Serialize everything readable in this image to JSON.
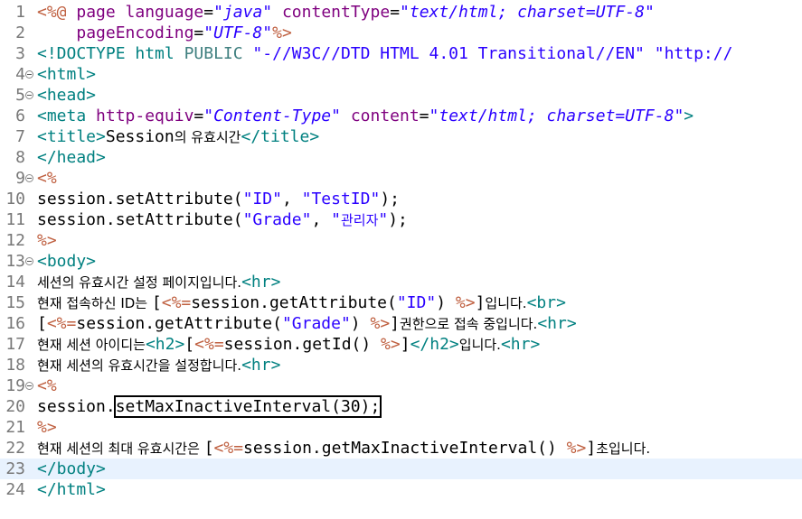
{
  "lines": [
    {
      "n": "1",
      "parts": [
        [
          "jsp",
          "<%@ "
        ],
        [
          "attr",
          "page "
        ],
        [
          "attr",
          "language"
        ],
        [
          "txt",
          "="
        ],
        [
          "str",
          "\"java\""
        ],
        [
          "txt",
          " "
        ],
        [
          "attr",
          "contentType"
        ],
        [
          "txt",
          "="
        ],
        [
          "str",
          "\"text/html; charset=UTF-8\""
        ]
      ]
    },
    {
      "n": "2",
      "parts": [
        [
          "txt",
          "    "
        ],
        [
          "attr",
          "pageEncoding"
        ],
        [
          "txt",
          "="
        ],
        [
          "str",
          "\"UTF-8\""
        ],
        [
          "jsp",
          "%>"
        ]
      ]
    },
    {
      "n": "3",
      "parts": [
        [
          "tag",
          "<!DOCTYPE html "
        ],
        [
          "kw",
          "PUBLIC "
        ],
        [
          "jstr",
          "\"-//W3C//DTD HTML 4.01 Transitional//EN\" \"http://"
        ]
      ]
    },
    {
      "n": "4",
      "fold": true,
      "parts": [
        [
          "tag",
          "<html>"
        ]
      ]
    },
    {
      "n": "5",
      "fold": true,
      "parts": [
        [
          "tag",
          "<head>"
        ]
      ]
    },
    {
      "n": "6",
      "parts": [
        [
          "tag",
          "<meta "
        ],
        [
          "attr",
          "http-equiv"
        ],
        [
          "txt",
          "="
        ],
        [
          "str",
          "\"Content-Type\""
        ],
        [
          "txt",
          " "
        ],
        [
          "attr",
          "content"
        ],
        [
          "txt",
          "="
        ],
        [
          "str",
          "\"text/html; charset=UTF-8\""
        ],
        [
          "tag",
          ">"
        ]
      ]
    },
    {
      "n": "7",
      "parts": [
        [
          "tag",
          "<title>"
        ],
        [
          "txt",
          "Session"
        ],
        [
          "ko",
          "의 유효시간"
        ],
        [
          "tag",
          "</title>"
        ]
      ]
    },
    {
      "n": "8",
      "parts": [
        [
          "tag",
          "</head>"
        ]
      ]
    },
    {
      "n": "9",
      "fold": true,
      "parts": [
        [
          "jsp",
          "<%"
        ]
      ]
    },
    {
      "n": "10",
      "parts": [
        [
          "txt",
          "session.setAttribute("
        ],
        [
          "jstr",
          "\"ID\""
        ],
        [
          "txt",
          ", "
        ],
        [
          "jstr",
          "\"TestID\""
        ],
        [
          "txt",
          ");"
        ]
      ]
    },
    {
      "n": "11",
      "parts": [
        [
          "txt",
          "session.setAttribute("
        ],
        [
          "jstr",
          "\"Grade\""
        ],
        [
          "txt",
          ", "
        ],
        [
          "jstr",
          "\""
        ],
        [
          "jstrko",
          "관리자"
        ],
        [
          "jstr",
          "\""
        ],
        [
          "txt",
          ");"
        ]
      ]
    },
    {
      "n": "12",
      "parts": [
        [
          "jsp",
          "%>"
        ]
      ]
    },
    {
      "n": "13",
      "fold": true,
      "parts": [
        [
          "tag",
          "<body>"
        ]
      ]
    },
    {
      "n": "14",
      "parts": [
        [
          "ko",
          "세션의 유효시간 설정 페이지입니다."
        ],
        [
          "tag",
          "<hr>"
        ]
      ]
    },
    {
      "n": "15",
      "parts": [
        [
          "ko",
          "현재 접속하신 ID는 "
        ],
        [
          "txt",
          "["
        ],
        [
          "jsp",
          "<%="
        ],
        [
          "txt",
          "session.getAttribute("
        ],
        [
          "jstr",
          "\"ID\""
        ],
        [
          "txt",
          ") "
        ],
        [
          "jsp",
          "%>"
        ],
        [
          "txt",
          "]"
        ],
        [
          "ko",
          "입니다."
        ],
        [
          "tag",
          "<br>"
        ]
      ]
    },
    {
      "n": "16",
      "parts": [
        [
          "txt",
          "["
        ],
        [
          "jsp",
          "<%="
        ],
        [
          "txt",
          "session.getAttribute("
        ],
        [
          "jstr",
          "\"Grade\""
        ],
        [
          "txt",
          ") "
        ],
        [
          "jsp",
          "%>"
        ],
        [
          "txt",
          "]"
        ],
        [
          "ko",
          "권한으로 접속 중입니다."
        ],
        [
          "tag",
          "<hr>"
        ]
      ]
    },
    {
      "n": "17",
      "parts": [
        [
          "ko",
          "현재 세션 아이디는"
        ],
        [
          "tag",
          "<h2>"
        ],
        [
          "txt",
          "["
        ],
        [
          "jsp",
          "<%="
        ],
        [
          "txt",
          "session.getId() "
        ],
        [
          "jsp",
          "%>"
        ],
        [
          "txt",
          "]"
        ],
        [
          "tag",
          "</h2>"
        ],
        [
          "ko",
          "입니다."
        ],
        [
          "tag",
          "<hr>"
        ]
      ]
    },
    {
      "n": "18",
      "parts": [
        [
          "ko",
          "현재 세션의 유효시간을 설정합니다."
        ],
        [
          "tag",
          "<hr>"
        ]
      ]
    },
    {
      "n": "19",
      "fold": true,
      "parts": [
        [
          "jsp",
          "<%"
        ]
      ]
    },
    {
      "n": "20",
      "parts": [
        [
          "txt",
          "session."
        ],
        [
          "boxed",
          "setMaxInactiveInterval(30);"
        ]
      ]
    },
    {
      "n": "21",
      "parts": [
        [
          "jsp",
          "%>"
        ]
      ]
    },
    {
      "n": "22",
      "parts": [
        [
          "ko",
          "현재 세션의 최대 유효시간은 "
        ],
        [
          "txt",
          "["
        ],
        [
          "jsp",
          "<%="
        ],
        [
          "txt",
          "session.getMaxInactiveInterval() "
        ],
        [
          "jsp",
          "%>"
        ],
        [
          "txt",
          "]"
        ],
        [
          "ko",
          "초입니다."
        ]
      ]
    },
    {
      "n": "23",
      "current": true,
      "parts": [
        [
          "tag",
          "</body>"
        ]
      ]
    },
    {
      "n": "24",
      "parts": [
        [
          "tag",
          "</html>"
        ]
      ]
    }
  ]
}
